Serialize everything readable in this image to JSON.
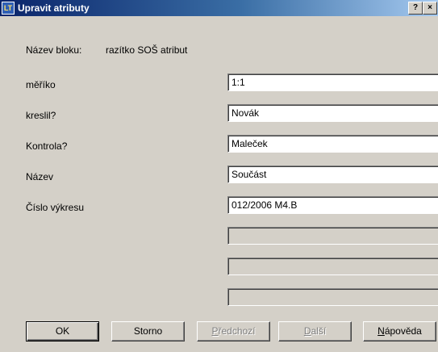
{
  "window": {
    "title": "Upravit atributy",
    "app_icon_text": "LT",
    "help_button": "?",
    "close_button": "×"
  },
  "block": {
    "label": "Název bloku:",
    "value": "razítko SOŠ atribut"
  },
  "attributes": [
    {
      "label": "měříko",
      "value": "1:1"
    },
    {
      "label": "kreslil?",
      "value": "Novák"
    },
    {
      "label": "Kontrola?",
      "value": "Maleček"
    },
    {
      "label": "Název",
      "value": "Součást"
    },
    {
      "label": "Číslo výkresu",
      "value": "012/2006 M4.B"
    },
    {
      "label": "",
      "value": ""
    },
    {
      "label": "",
      "value": ""
    },
    {
      "label": "",
      "value": ""
    }
  ],
  "buttons": {
    "ok": "OK",
    "cancel": "Storno",
    "previous_first": "P",
    "previous_rest": "ředchozí",
    "next_first": "D",
    "next_rest": "alší",
    "help_first": "N",
    "help_rest": "ápověda"
  }
}
